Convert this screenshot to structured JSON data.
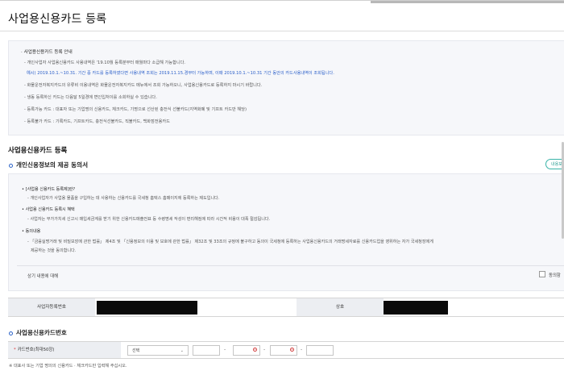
{
  "page": {
    "title": "사업용신용카드 등록"
  },
  "guide": {
    "title": "사업용신용카드 등록 안내",
    "lines": [
      "개인사업자 사업용신용카드 사용내역은 '19.10월 등록분부터 매월마다 소급해 가능합니다.",
      "예시) 2019.10.1.~10.31. 기간 중 카드를 등록하였다면 사용내역 조회는 2019.11.15.경부터 가능하며, 이때 2019.10.1.~10.31 기간 동안의 카드사용내역이 조회됩니다.",
      "화물운전자복지카드의 유류비 이용내역은 화물운전자복지카드 메뉴에서 조회 가능하오니, 사업용신용카드로 등록하지 마시기 바랍니다.",
      "냉동 등록하신 카드는 다음달 5일경에 변인입처이를 소회하실 수 있습니다.",
      "등록가능 카드 : 대표자 또는 기업명의 신용카드, 체크카드, 기명으로 선산된 충전식 선불카드(지역화폐 및 기프트 카드만 해당)",
      "등록불가 카드 : 기록카드, 기프트카드, 충전식선불카드, 직불카드, 백화점전용카드"
    ]
  },
  "register": {
    "heading": "사업용신용카드 등록",
    "consent_heading": "개인신용정보의 제공 동의서",
    "detail_button": "내용보기",
    "consent_items": [
      {
        "head": "[사업용 신용카드 등록제]란?",
        "body": "개인사업자가 사업용 물품을 구입하는 데 사용하는 신용카드를 국세청 홈택스 홈페이지에 등록하는 제도입니다."
      },
      {
        "head": "사업용 신용카드 등록시 혜택",
        "body": "사업자는 부가가치세 신고시 매입세금계를 받기 위한 신용카드매출전표 등 수령명세 작성이 편리해짐에 따라 시간적 비용이 대폭 절감됩니다."
      },
      {
        "head": "동의내용",
        "body": "「금융실명거래 및 비밀보장에 관한 법률」 제4조 및 「신용정보의 이용 및 보호에 관한 법률」 제32조 및 33조의 규정에 불구하고 동의이 국세청에 등록하는 사업용신용카드의 거래명세자료를 신용카드업을 영위하는 자가 국세청장에게",
        "body2": "제공하는 것을 동의합니다."
      }
    ],
    "agree_text": "상기 내용에 대해",
    "agree_checkbox_label": "동의함"
  },
  "info": {
    "biz_no_label": "사업자등록번호",
    "company_label": "상호"
  },
  "card": {
    "heading": "사업용신용카드번호",
    "field_label": "카드번호(최대50장)",
    "required_mark": "*",
    "select_value": "선택",
    "separator": "-",
    "note": "※ 대표사 또는 기업 명의의 신용카드 · 체크카드만 입력해 주십시오."
  },
  "colors": {
    "accent_blue": "#2d63c8",
    "pill_teal": "#39b3a8",
    "label_bg": "#eceef2",
    "redacted": "#0a0a0a"
  }
}
